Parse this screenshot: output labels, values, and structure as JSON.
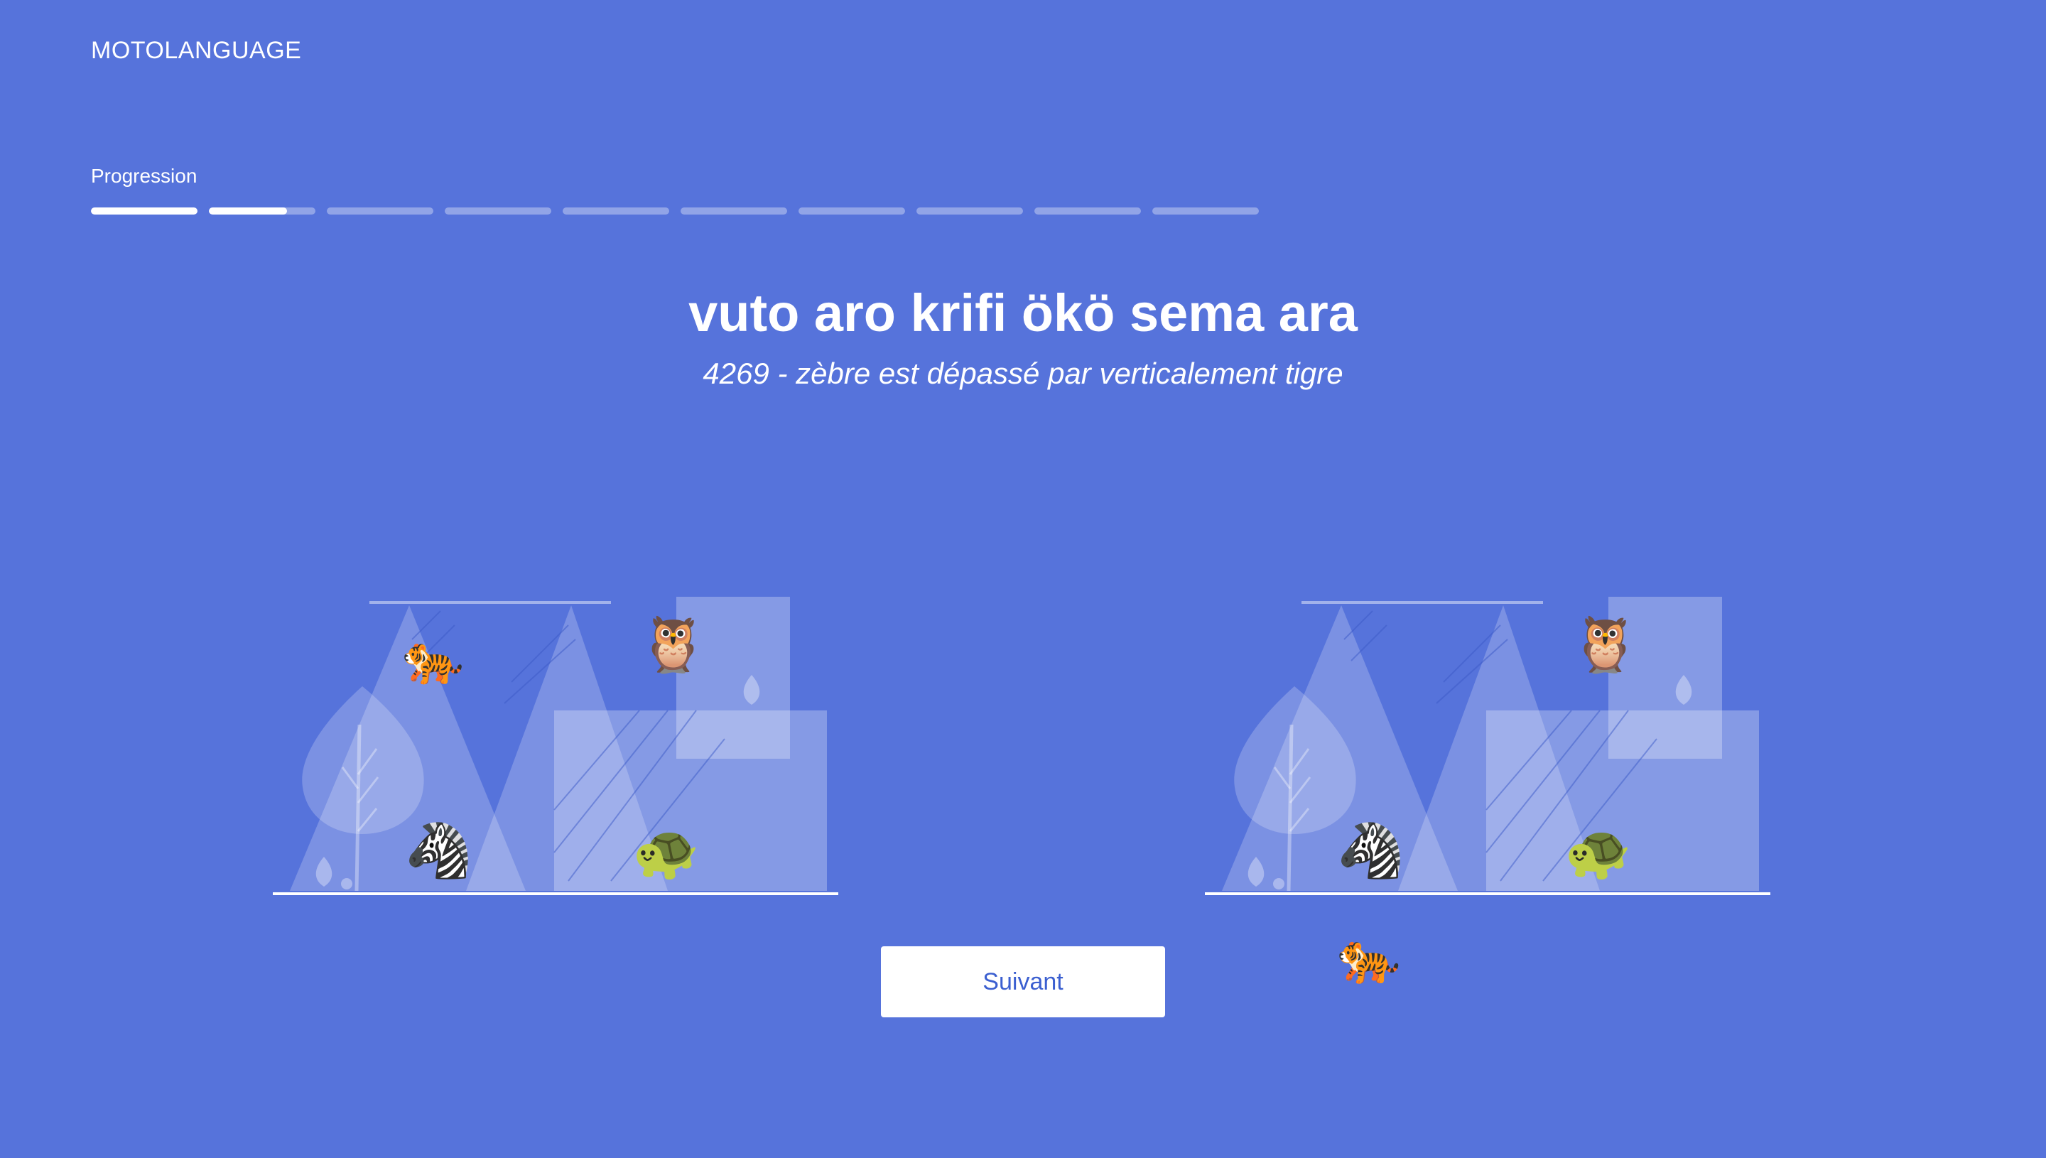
{
  "brand": "MOTOLANGUAGE",
  "progress": {
    "label": "Progression",
    "segments": [
      1,
      0.73,
      0,
      0,
      0,
      0,
      0,
      0,
      0,
      0
    ]
  },
  "exercise": {
    "sentence": "vuto aro krifi ökö sema ara",
    "translation": "4269 - zèbre est dépassé par verticalement tigre"
  },
  "scenes": {
    "left": {
      "animals": [
        "tiger",
        "owl",
        "zebra",
        "turtle"
      ]
    },
    "right": {
      "animals": [
        "owl",
        "zebra",
        "turtle"
      ]
    },
    "draggable": "tiger"
  },
  "emoji": {
    "tiger": "🐅",
    "owl": "🦉",
    "zebra": "🦓",
    "turtle": "🐢"
  },
  "next_button": "Suivant",
  "colors": {
    "background": "#5673db",
    "button_text": "#3b5fd0"
  }
}
